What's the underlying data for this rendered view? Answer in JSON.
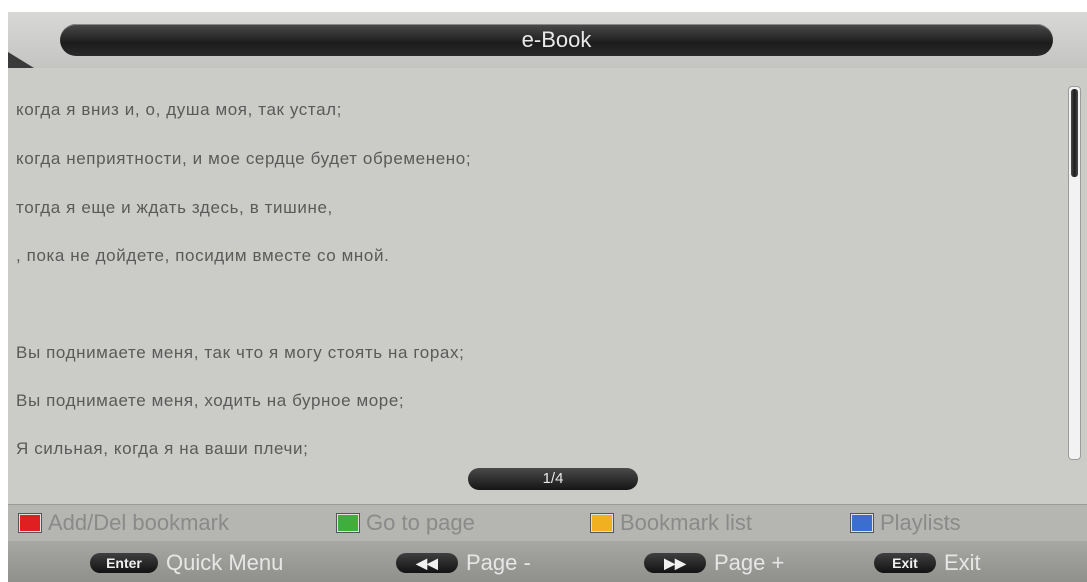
{
  "app": {
    "title": "e-Book"
  },
  "text_lines": [
    "когда я вниз и, о, душа моя, так устал;",
    "когда неприятности, и мое сердце будет обременено;",
    "тогда я еще и ждать здесь, в тишине,",
    ", пока не дойдете, посидим вместе со мной.",
    "",
    "Вы поднимаете меня, так что я могу стоять на горах;",
    "Вы поднимаете меня, ходить на бурное море;",
    "Я сильная, когда я на ваши плечи;"
  ],
  "page_indicator": "1/4",
  "scroll": {
    "position_fraction": 0.0
  },
  "color_buttons": [
    {
      "label": "Add/Del bookmark",
      "color": "#e02020"
    },
    {
      "label": "Go to page",
      "color": "#3fae3a"
    },
    {
      "label": "Bookmark list",
      "color": "#f0b020"
    },
    {
      "label": "Playlists",
      "color": "#3a6fd0"
    }
  ],
  "key_hints": [
    {
      "key": "Enter",
      "label": "Quick Menu"
    },
    {
      "key": "◀◀",
      "label": "Page -"
    },
    {
      "key": "▶▶",
      "label": "Page +"
    },
    {
      "key": "Exit",
      "label": "Exit"
    }
  ]
}
